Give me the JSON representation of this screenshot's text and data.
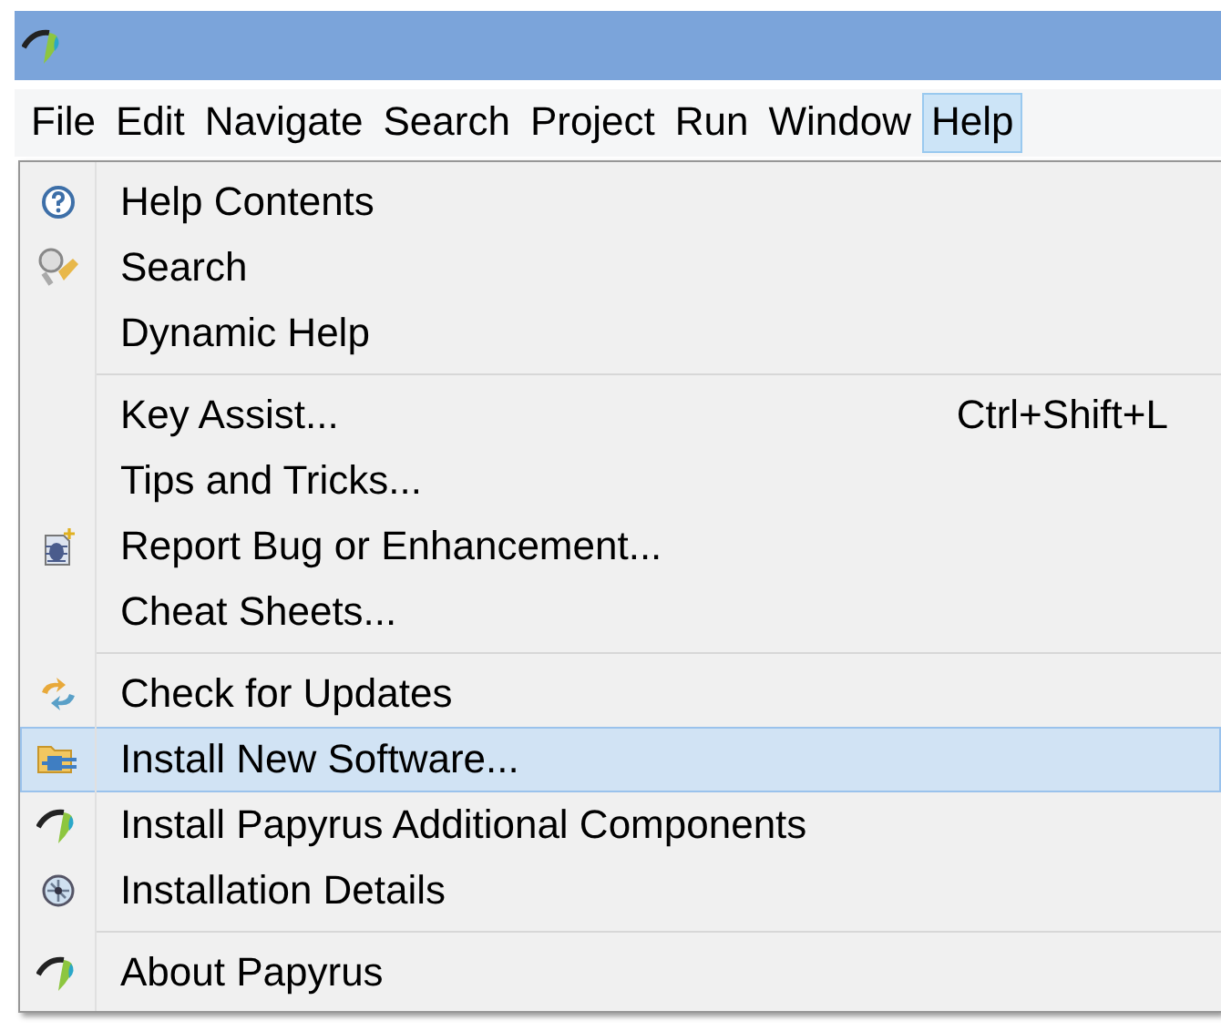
{
  "menu_bar": [
    {
      "label": "File",
      "selected": false
    },
    {
      "label": "Edit",
      "selected": false
    },
    {
      "label": "Navigate",
      "selected": false
    },
    {
      "label": "Search",
      "selected": false
    },
    {
      "label": "Project",
      "selected": false
    },
    {
      "label": "Run",
      "selected": false
    },
    {
      "label": "Window",
      "selected": false
    },
    {
      "label": "Help",
      "selected": true
    }
  ],
  "menu_groups": [
    [
      {
        "label": "Help Contents",
        "kind": "help",
        "selected": false
      },
      {
        "label": "Search",
        "kind": "search",
        "selected": false
      },
      {
        "label": "Dynamic Help",
        "kind": "plain",
        "selected": false
      }
    ],
    [
      {
        "label": "Key Assist...",
        "kind": "plain",
        "shortcut": "Ctrl+Shift+L",
        "selected": false
      },
      {
        "label": "Tips and Tricks...",
        "kind": "plain",
        "selected": false
      },
      {
        "label": "Report Bug or Enhancement...",
        "kind": "bug",
        "selected": false
      },
      {
        "label": "Cheat Sheets...",
        "kind": "plain",
        "selected": false
      }
    ],
    [
      {
        "label": "Check for Updates",
        "kind": "update",
        "selected": false
      },
      {
        "label": "Install New Software...",
        "kind": "install",
        "selected": true
      },
      {
        "label": "Install Papyrus Additional Components",
        "kind": "papyrus",
        "selected": false
      },
      {
        "label": "Installation Details",
        "kind": "details",
        "selected": false
      }
    ],
    [
      {
        "label": "About Papyrus",
        "kind": "papyrus",
        "selected": false
      }
    ]
  ]
}
